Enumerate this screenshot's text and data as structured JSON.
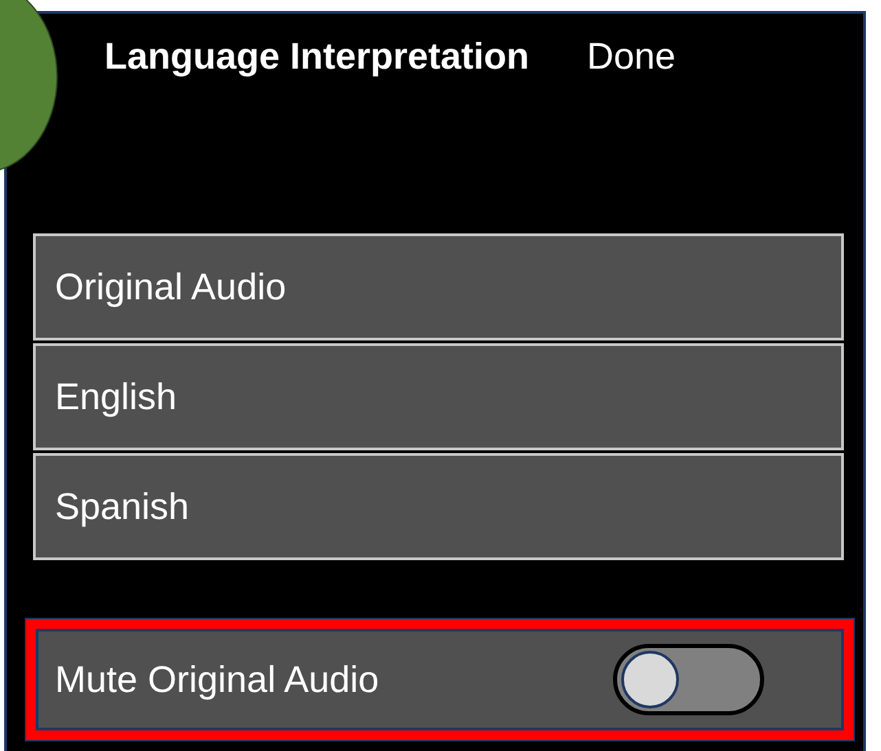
{
  "header": {
    "title": "Language Interpretation",
    "done": "Done"
  },
  "languages": [
    {
      "label": "Original Audio"
    },
    {
      "label": "English"
    },
    {
      "label": "Spanish"
    }
  ],
  "mute": {
    "label": "Mute Original Audio",
    "on": false,
    "highlighted": true
  }
}
